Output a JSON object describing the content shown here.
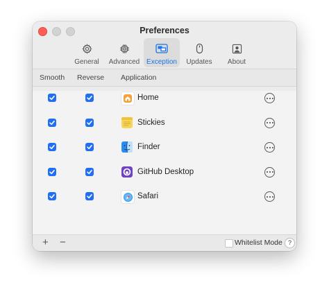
{
  "window": {
    "title": "Preferences"
  },
  "toolbar": {
    "tabs": [
      {
        "label": "General",
        "icon": "gear-icon"
      },
      {
        "label": "Advanced",
        "icon": "chip-icon"
      },
      {
        "label": "Exception",
        "icon": "exception-icon",
        "active": true
      },
      {
        "label": "Updates",
        "icon": "update-icon"
      },
      {
        "label": "About",
        "icon": "person-icon"
      }
    ]
  },
  "table": {
    "headers": {
      "smooth": "Smooth",
      "reverse": "Reverse",
      "application": "Application"
    },
    "rows": [
      {
        "app": "Home",
        "smooth": true,
        "reverse": true,
        "icon": "home-app-icon"
      },
      {
        "app": "Stickies",
        "smooth": true,
        "reverse": true,
        "icon": "stickies-app-icon"
      },
      {
        "app": "Finder",
        "smooth": true,
        "reverse": true,
        "icon": "finder-app-icon"
      },
      {
        "app": "GitHub Desktop",
        "smooth": true,
        "reverse": true,
        "icon": "github-desktop-app-icon"
      },
      {
        "app": "Safari",
        "smooth": true,
        "reverse": true,
        "icon": "safari-app-icon"
      }
    ]
  },
  "bottom": {
    "add_symbol": "+",
    "remove_symbol": "−",
    "whitelist_label": "Whitelist Mode",
    "whitelist_checked": false,
    "help_symbol": "?"
  },
  "colors": {
    "accent": "#1f6ef5",
    "active_tab_text": "#1a73e8"
  }
}
